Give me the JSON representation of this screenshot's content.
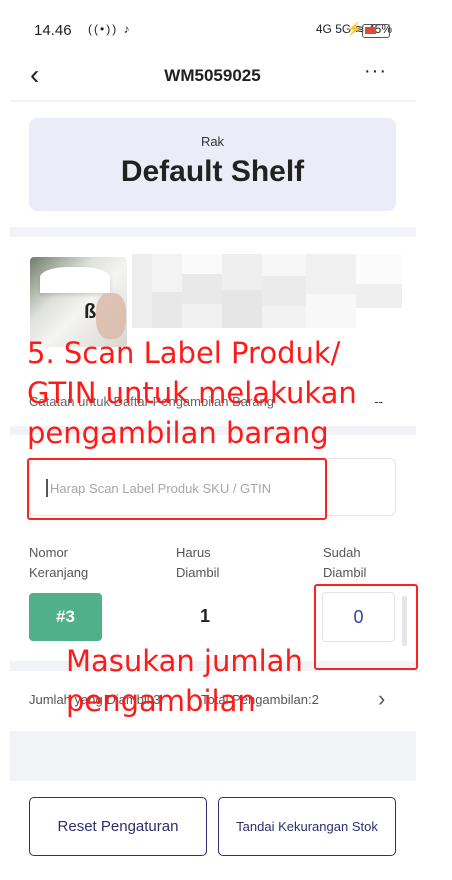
{
  "status_bar": {
    "time": "14.46",
    "left_icons": "((•)) ♪",
    "network": "4G 5G",
    "battery_percent": "45%"
  },
  "header": {
    "back_icon": "chevron-left-icon",
    "title": "WM5059025",
    "more_icon": "more-dots-icon"
  },
  "shelf": {
    "label": "Rak",
    "name": "Default Shelf"
  },
  "product": {
    "note_label": "Catatan untuk Daftar Pengambilan Barang",
    "note_value": "--"
  },
  "scan": {
    "placeholder": "Harap Scan Label Produk SKU / GTIN"
  },
  "columns": {
    "basket": "Nomor\nKeranjang",
    "required": "Harus\nDiambil",
    "taken": "Sudah\nDiambil"
  },
  "row": {
    "basket_number": "#3",
    "required_qty": "1",
    "taken_qty": "0"
  },
  "summary": {
    "taken_label": "Jumlah yang Diambil:3",
    "total_label": "Total Pengambilan:2"
  },
  "buttons": {
    "reset": "Reset Pengaturan",
    "shortage": "Tandai Kekurangan Stok"
  },
  "annotations": {
    "scan_instruction": "5. Scan Label Produk/\nGTIN untuk melakukan\npengambilan barang",
    "qty_instruction": "Masukan jumlah\npengambilan"
  },
  "colors": {
    "accent": "#2d2f6e",
    "basket_badge": "#4fb08a",
    "shelf_card": "#ececf8",
    "annotation": "#ff1a1a"
  }
}
